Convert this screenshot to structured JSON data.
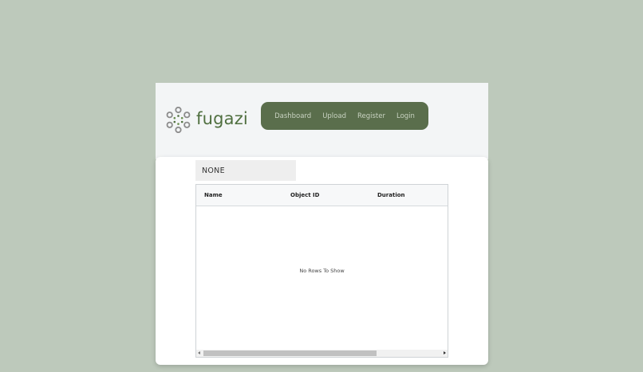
{
  "header": {
    "logo_text": "fugazi",
    "nav": [
      {
        "label": "Dashboard"
      },
      {
        "label": "Upload"
      },
      {
        "label": "Register"
      },
      {
        "label": "Login"
      }
    ]
  },
  "filter": {
    "selected": "NONE"
  },
  "grid": {
    "columns": [
      "Name",
      "Object ID",
      "Duration"
    ],
    "empty_message": "No Rows To Show",
    "scroll_fraction": 0.72
  },
  "colors": {
    "background": "#bdc9bb",
    "nav_background": "#5a6e4c",
    "brand": "#4f6f3f"
  }
}
